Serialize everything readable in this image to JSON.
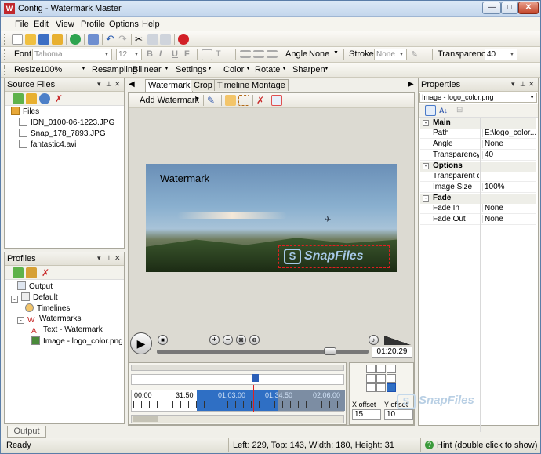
{
  "window": {
    "title": "Config - Watermark Master",
    "minimize": "0",
    "maximize": "1",
    "close": "r",
    "app_icon": "W"
  },
  "menu": [
    "File",
    "Edit",
    "View",
    "Profile",
    "Options",
    "Help"
  ],
  "format_toolbar": {
    "font_label": "Font",
    "font_value": "Tahoma",
    "font_size": "12",
    "bold": "B",
    "italic": "I",
    "underline": "U",
    "strike": "F",
    "angle_label": "Angle",
    "angle_value": "None",
    "stroke_label": "Stroke",
    "stroke_value": "None",
    "transparency_label": "Transparency",
    "transparency_value": "40"
  },
  "image_toolbar": {
    "resize_label": "Resize",
    "resize_value": "100%",
    "resampling_label": "Resampling",
    "resampling_value": "Bilinear",
    "settings": "Settings",
    "color": "Color",
    "rotate": "Rotate",
    "sharpen": "Sharpen"
  },
  "source_files": {
    "title": "Source Files",
    "root": "Files",
    "items": [
      "IDN_0100-06-1223.JPG",
      "Snap_178_7893.JPG",
      "fantastic4.avi"
    ]
  },
  "profiles": {
    "title": "Profiles",
    "output": "Output",
    "default": "Default",
    "timelines": "Timelines",
    "watermarks": "Watermarks",
    "text_wm": "Text - Watermark",
    "image_wm": "Image - logo_color.png"
  },
  "editor": {
    "tabs": [
      "Watermark",
      "Crop",
      "Timeline",
      "Montage"
    ],
    "add_watermark": "Add Watermark",
    "preview_text": "Watermark",
    "logo_text": "SnapFiles",
    "time": "01:20.29",
    "progress": 0.84
  },
  "timeline": {
    "ticks": [
      "00.00",
      "31.50",
      "01:03.00",
      "01:34.50",
      "02:06.00"
    ],
    "x_offset_label": "X offset",
    "y_offset_label": "Y offset",
    "x_offset": "15",
    "y_offset": "10"
  },
  "properties": {
    "title": "Properties",
    "selector": "Image - logo_color.png",
    "groups": [
      {
        "name": "Main",
        "rows": [
          [
            "Path",
            "E:\\logo_color...."
          ],
          [
            "Angle",
            "None"
          ],
          [
            "Transparency",
            "40"
          ]
        ]
      },
      {
        "name": "Options",
        "rows": [
          [
            "Transparent co",
            ""
          ],
          [
            "Image Size",
            "100%"
          ]
        ]
      },
      {
        "name": "Fade",
        "rows": [
          [
            "Fade In",
            "None"
          ],
          [
            "Fade Out",
            "None"
          ]
        ]
      }
    ],
    "watermark_logo": "SnapFiles"
  },
  "bottom_tab": "Output",
  "status": {
    "left": "Ready",
    "center": "Left: 229, Top: 143, Width: 180, Height: 31",
    "hint": "Hint (double click to show)"
  }
}
